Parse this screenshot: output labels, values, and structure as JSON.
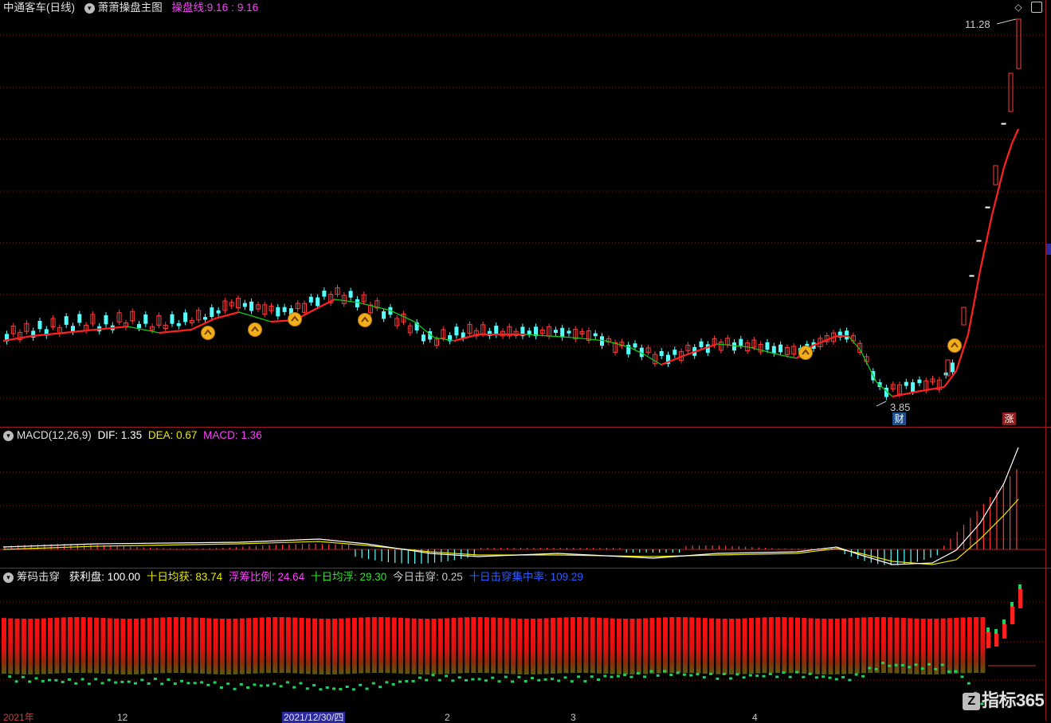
{
  "main": {
    "stock": "中通客车(日线)",
    "indicator_name": "萧萧操盘主图",
    "line_label": "操盘线:",
    "line_value": "9.16",
    "line_value2": "9.16",
    "high_label": "11.28",
    "low_label": "3.85",
    "badge_cai": "财",
    "badge_zhang": "涨"
  },
  "macd": {
    "name": "MACD(12,26,9)",
    "dif": "DIF: 1.35",
    "dea": "DEA: 0.67",
    "macd": "MACD: 1.36"
  },
  "chip": {
    "name": "筹码击穿",
    "profit": "获利盘: 100.00",
    "avg10_profit": "十日均获: 83.74",
    "float_ratio": "浮筹比例: 24.64",
    "avg10_float": "十日均浮: 29.30",
    "today_break": "今日击穿: 0.25",
    "break_conc": "十日击穿集中率: 109.29"
  },
  "xaxis": {
    "labels": [
      "2021年",
      "12",
      "2021/12/30/四",
      "2",
      "3",
      "4"
    ]
  },
  "logo_text": "指标365",
  "logo_mark": "Z",
  "colors": {
    "up": "#ff3b3b",
    "down": "#54ffff",
    "ma_up": "#ff2020",
    "ma_down": "#12c812",
    "dif": "#ffffff",
    "dea": "#e8e800",
    "grid": "#8a1515"
  }
}
